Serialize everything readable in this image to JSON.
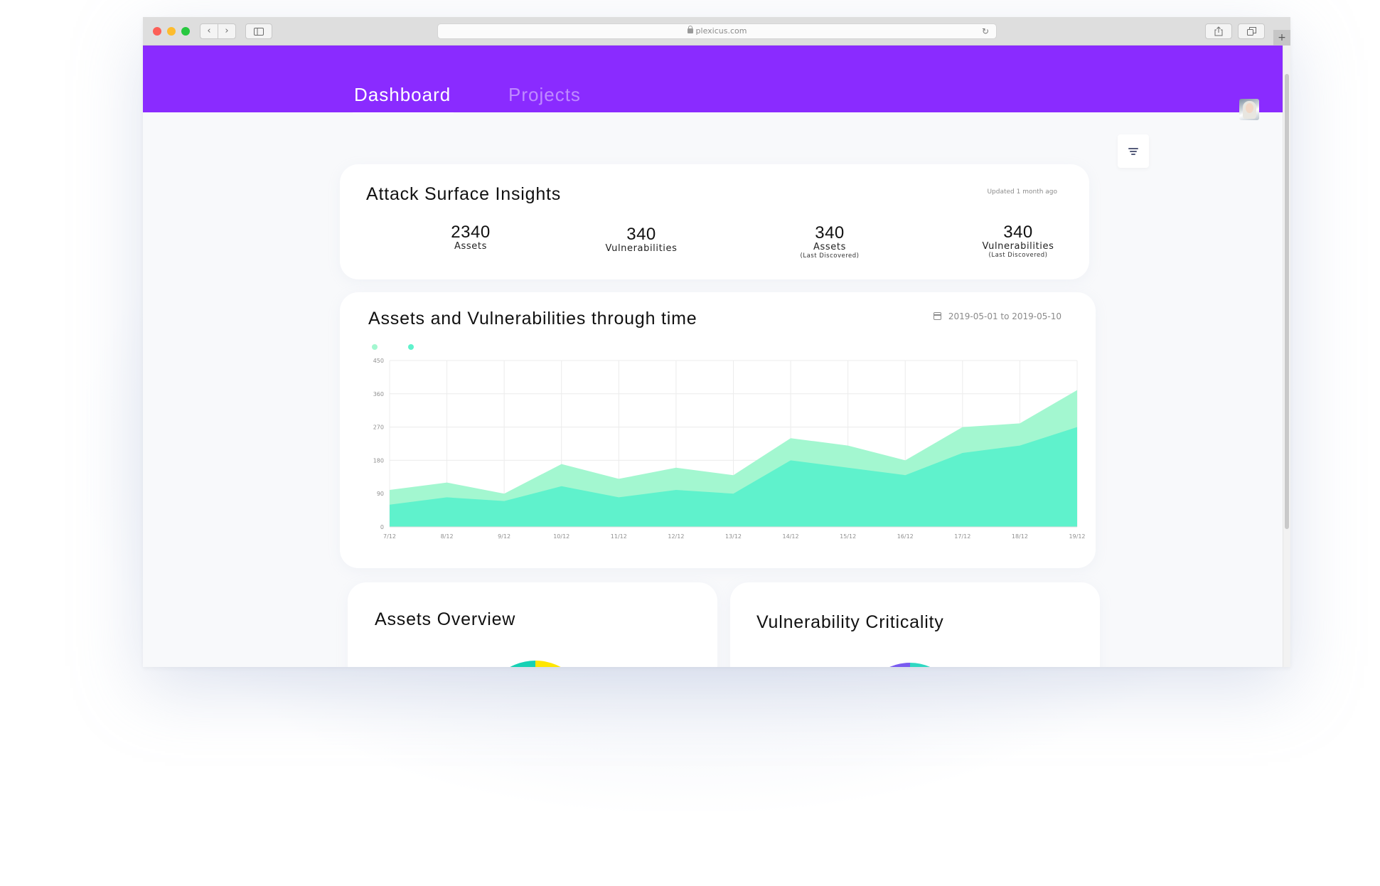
{
  "browser": {
    "url": "plexicus.com",
    "back_icon": "‹",
    "forward_icon": "›",
    "reload_icon": "↻",
    "new_tab_icon": "+"
  },
  "nav": {
    "tabs": [
      "Dashboard",
      "Projects"
    ],
    "active_tab": "Dashboard",
    "accent_color": "#8a2bff"
  },
  "insights": {
    "title": "Attack Surface Insights",
    "updated": "Updated 1 month ago",
    "stats": [
      {
        "value": "2340",
        "label": "Assets",
        "sub": ""
      },
      {
        "value": "340",
        "label": "Vulnerabilities",
        "sub": ""
      },
      {
        "value": "340",
        "label": "Assets",
        "sub": "(Last Discovered)"
      },
      {
        "value": "340",
        "label": "Vulnerabilities",
        "sub": "(Last Discovered)"
      }
    ]
  },
  "timeline": {
    "title": "Assets and Vulnerabilities through time",
    "date_range": "2019-05-01 to 2019-05-10"
  },
  "assets_overview": {
    "title": "Assets Overview",
    "slice_colors": [
      "#16d1b4",
      "#ffe600"
    ]
  },
  "vuln_criticality": {
    "title": "Vulnerability Criticality",
    "slice_colors": [
      "#7a5bf0",
      "#2fd8c2",
      "#ff9a3c"
    ]
  },
  "chart_data": {
    "type": "area",
    "x": [
      "7/12",
      "8/12",
      "9/12",
      "10/12",
      "11/12",
      "12/12",
      "13/12",
      "14/12",
      "15/12",
      "16/12",
      "17/12",
      "18/12",
      "19/12"
    ],
    "series": [
      {
        "color": "#a3f7d0",
        "values": [
          100,
          120,
          90,
          170,
          130,
          160,
          140,
          240,
          220,
          180,
          270,
          280,
          370
        ]
      },
      {
        "color": "#5ff2cc",
        "values": [
          60,
          80,
          70,
          110,
          80,
          100,
          90,
          180,
          160,
          140,
          200,
          220,
          270
        ]
      }
    ],
    "yticks": [
      0,
      90,
      180,
      270,
      360,
      450
    ],
    "ylim": [
      0,
      450
    ],
    "grid": true,
    "legend": "top-left"
  }
}
